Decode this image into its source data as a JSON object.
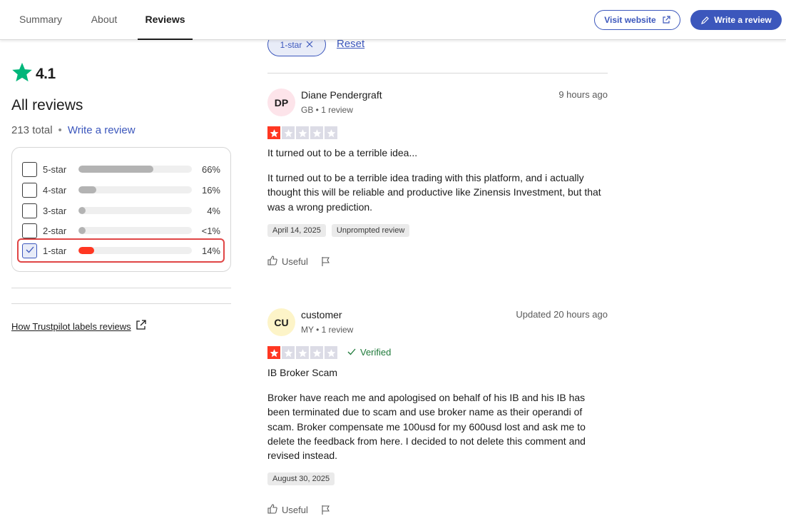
{
  "nav": {
    "tabs": [
      {
        "label": "Summary"
      },
      {
        "label": "About"
      },
      {
        "label": "Reviews"
      }
    ],
    "visit_website": "Visit website",
    "write_review": "Write a review"
  },
  "summary": {
    "rating": "4.1",
    "heading": "All reviews",
    "total": "213 total",
    "separator": "•",
    "write_link": "Write a review",
    "accent_color": "#00b67a"
  },
  "filters": [
    {
      "label": "5-star",
      "percent": "66%",
      "fill": 0.66,
      "checked": false
    },
    {
      "label": "4-star",
      "percent": "16%",
      "fill": 0.16,
      "checked": false
    },
    {
      "label": "3-star",
      "percent": "4%",
      "fill": 0.04,
      "checked": false
    },
    {
      "label": "2-star",
      "percent": "<1%",
      "fill": 0.01,
      "checked": false
    },
    {
      "label": "1-star",
      "percent": "14%",
      "fill": 0.14,
      "checked": true
    }
  ],
  "labels_link": "How Trustpilot labels reviews",
  "active_filter": {
    "chip": "1-star",
    "reset": "Reset"
  },
  "reviews": [
    {
      "initials": "DP",
      "avatar_color": "#fde4ea",
      "name": "Diane Pendergraft",
      "meta": "GB • 1 review",
      "time": "9 hours ago",
      "stars": 1,
      "verified": "",
      "title": "It turned out to be a terrible idea...",
      "body": "It turned out to be a terrible idea trading with this platform, and i actually thought this will be reliable and productive like Zinensis Investment, but that was a wrong prediction.",
      "tags": [
        "April 14, 2025",
        "Unprompted review"
      ],
      "useful": "Useful"
    },
    {
      "initials": "CU",
      "avatar_color": "#fdf4c8",
      "name": "customer",
      "meta": "MY • 1 review",
      "time": "Updated 20 hours ago",
      "stars": 1,
      "verified": "Verified",
      "title": "IB Broker Scam",
      "body": "Broker have reach me and apologised on behalf of his IB and his IB has been terminated due to scam and use broker name as their operandi of scam. Broker compensate me 100usd for my 600usd lost and ask me to delete the feedback from here. I decided to not delete this comment and revised instead.",
      "tags": [
        "August 30, 2025"
      ],
      "useful": "Useful"
    }
  ],
  "colors": {
    "brand_blue": "#3c57bc",
    "star_red": "#ff3722",
    "highlight_red": "#e04545"
  }
}
